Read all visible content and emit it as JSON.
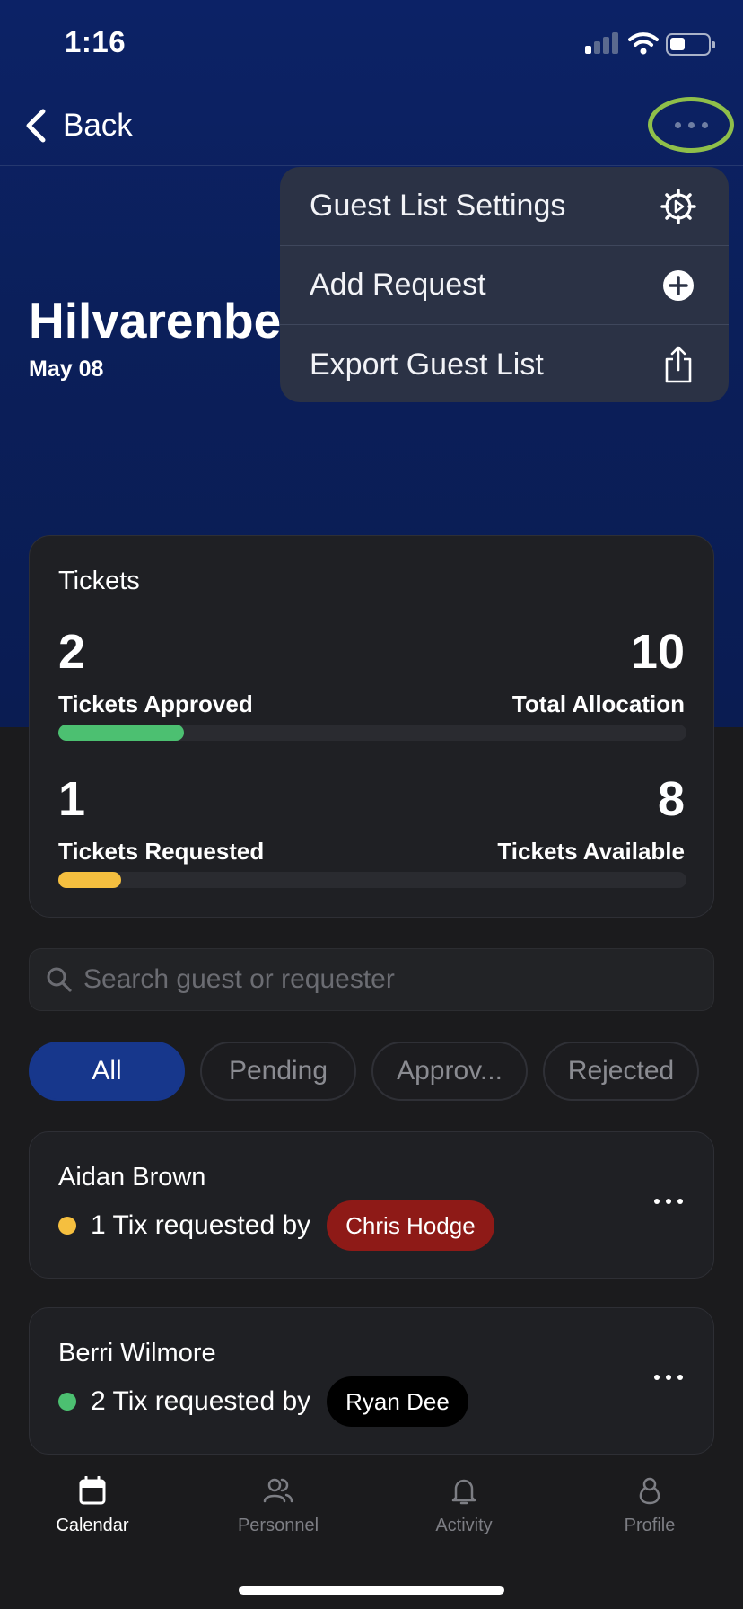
{
  "status_bar": {
    "time": "1:16"
  },
  "nav": {
    "back_label": "Back"
  },
  "event": {
    "title": "Hilvarenbe",
    "date": "May 08"
  },
  "menu": {
    "items": [
      {
        "label": "Guest List Settings",
        "icon": "gear-icon"
      },
      {
        "label": "Add Request",
        "icon": "plus-circle-icon"
      },
      {
        "label": "Export Guest List",
        "icon": "share-icon"
      }
    ]
  },
  "tickets": {
    "title": "Tickets",
    "approved": {
      "value": "2",
      "label": "Tickets Approved"
    },
    "allocation": {
      "value": "10",
      "label": "Total Allocation"
    },
    "approved_fraction": 0.2,
    "requested": {
      "value": "1",
      "label": "Tickets Requested"
    },
    "available": {
      "value": "8",
      "label": "Tickets Available"
    },
    "requested_fraction": 0.1,
    "colors": {
      "approved": "#4cc071",
      "requested": "#f5bf3f"
    }
  },
  "search": {
    "placeholder": "Search guest or requester"
  },
  "filters": [
    {
      "label": "All",
      "active": true
    },
    {
      "label": "Pending",
      "active": false
    },
    {
      "label": "Approv...",
      "active": false
    },
    {
      "label": "Rejected",
      "active": false
    }
  ],
  "guests": [
    {
      "name": "Aidan Brown",
      "status_color": "#f5bf3f",
      "request_text": "1 Tix requested by",
      "requester": "Chris Hodge",
      "requester_color": "#8e1a17"
    },
    {
      "name": "Berri Wilmore",
      "status_color": "#4cc071",
      "request_text": "2 Tix requested by",
      "requester": "Ryan Dee",
      "requester_color": "#000000"
    }
  ],
  "tabs": [
    {
      "label": "Calendar",
      "icon": "calendar-icon",
      "active": true
    },
    {
      "label": "Personnel",
      "icon": "people-icon",
      "active": false
    },
    {
      "label": "Activity",
      "icon": "bell-icon",
      "active": false
    },
    {
      "label": "Profile",
      "icon": "person-icon",
      "active": false
    }
  ]
}
